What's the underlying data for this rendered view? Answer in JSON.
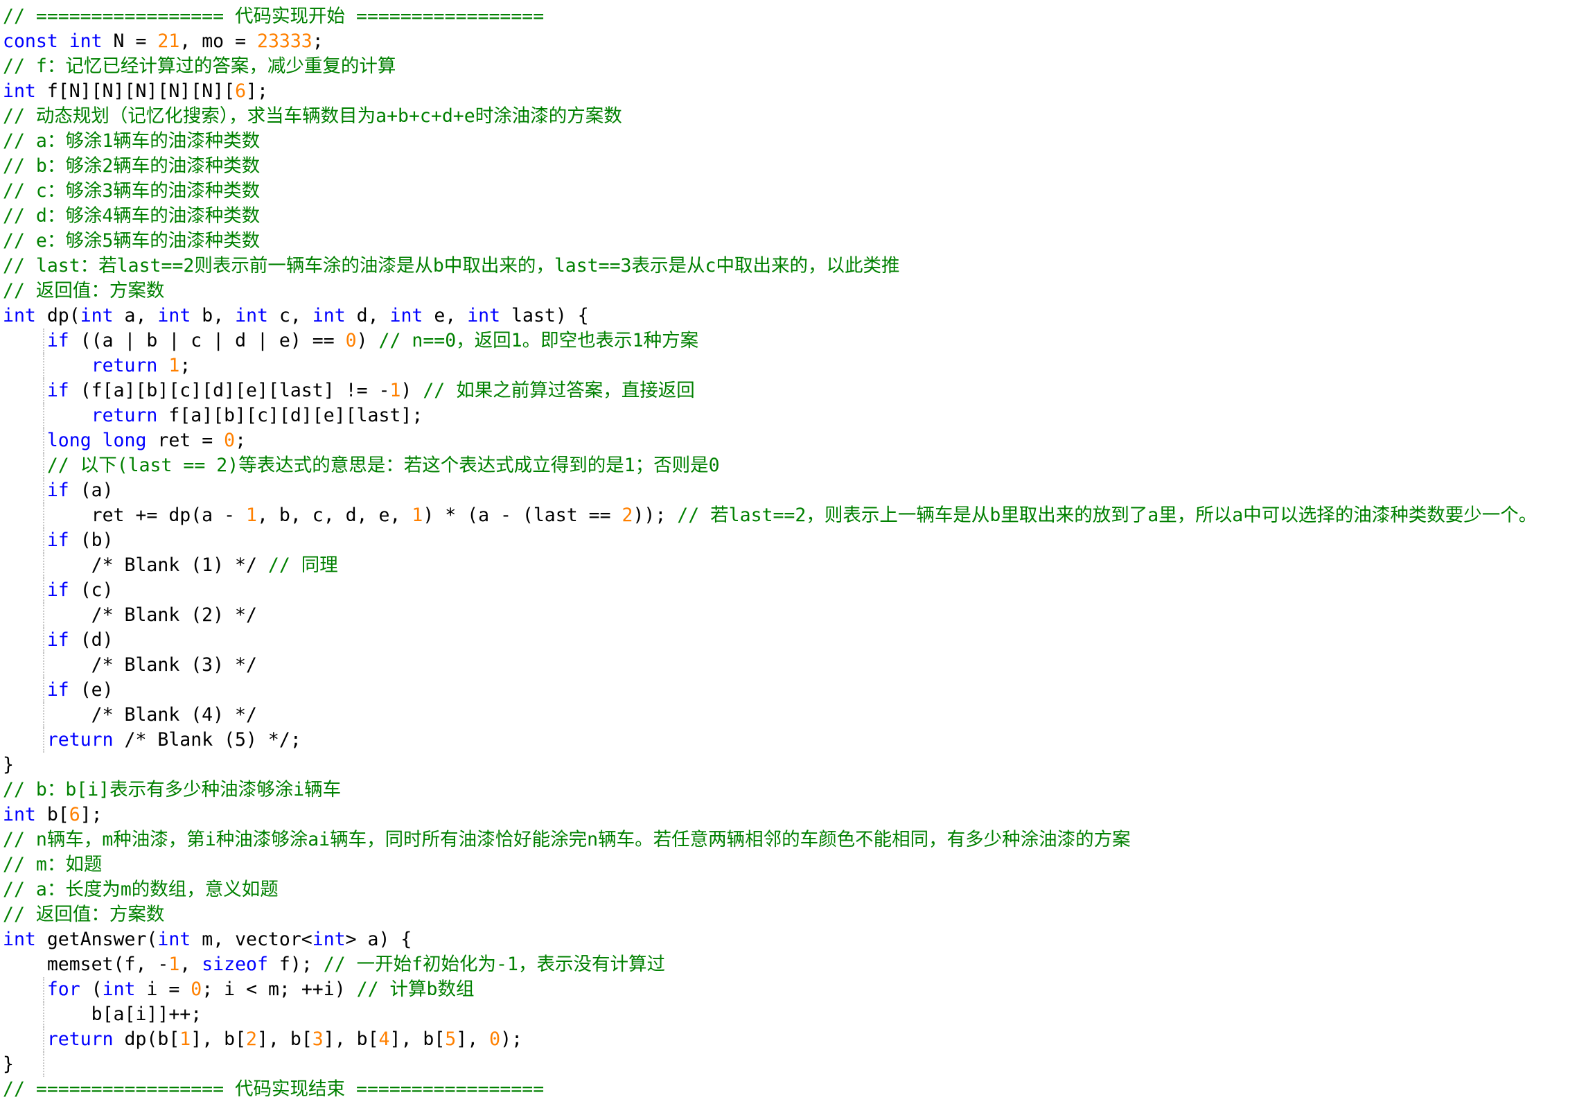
{
  "code_lines": [
    [
      {
        "t": "c",
        "s": "// ================= 代码实现开始 ================="
      }
    ],
    [
      {
        "t": "k",
        "s": "const int"
      },
      {
        "t": "p",
        "s": " N = "
      },
      {
        "t": "n",
        "s": "21"
      },
      {
        "t": "p",
        "s": ", mo = "
      },
      {
        "t": "n",
        "s": "23333"
      },
      {
        "t": "p",
        "s": ";"
      }
    ],
    [
      {
        "t": "c",
        "s": "// f：记忆已经计算过的答案，减少重复的计算"
      }
    ],
    [
      {
        "t": "k",
        "s": "int"
      },
      {
        "t": "p",
        "s": " f[N][N][N][N][N]["
      },
      {
        "t": "n",
        "s": "6"
      },
      {
        "t": "p",
        "s": "];"
      }
    ],
    [
      {
        "t": "c",
        "s": "// 动态规划（记忆化搜索），求当车辆数目为a+b+c+d+e时涂油漆的方案数"
      }
    ],
    [
      {
        "t": "c",
        "s": "// a：够涂1辆车的油漆种类数"
      }
    ],
    [
      {
        "t": "c",
        "s": "// b：够涂2辆车的油漆种类数"
      }
    ],
    [
      {
        "t": "c",
        "s": "// c：够涂3辆车的油漆种类数"
      }
    ],
    [
      {
        "t": "c",
        "s": "// d：够涂4辆车的油漆种类数"
      }
    ],
    [
      {
        "t": "c",
        "s": "// e：够涂5辆车的油漆种类数"
      }
    ],
    [
      {
        "t": "c",
        "s": "// last：若last==2则表示前一辆车涂的油漆是从b中取出来的，last==3表示是从c中取出来的，以此类推"
      }
    ],
    [
      {
        "t": "c",
        "s": "// 返回值：方案数"
      }
    ],
    [
      {
        "t": "k",
        "s": "int"
      },
      {
        "t": "p",
        "s": " dp("
      },
      {
        "t": "k",
        "s": "int"
      },
      {
        "t": "p",
        "s": " a, "
      },
      {
        "t": "k",
        "s": "int"
      },
      {
        "t": "p",
        "s": " b, "
      },
      {
        "t": "k",
        "s": "int"
      },
      {
        "t": "p",
        "s": " c, "
      },
      {
        "t": "k",
        "s": "int"
      },
      {
        "t": "p",
        "s": " d, "
      },
      {
        "t": "k",
        "s": "int"
      },
      {
        "t": "p",
        "s": " e, "
      },
      {
        "t": "k",
        "s": "int"
      },
      {
        "t": "p",
        "s": " last) {"
      }
    ],
    [
      {
        "t": "p",
        "s": "    "
      },
      {
        "t": "k",
        "s": "if"
      },
      {
        "t": "p",
        "s": " ((a | b | c | d | e) == "
      },
      {
        "t": "n",
        "s": "0"
      },
      {
        "t": "p",
        "s": ") "
      },
      {
        "t": "c",
        "s": "// n==0，返回1。即空也表示1种方案"
      }
    ],
    [
      {
        "t": "p",
        "s": "        "
      },
      {
        "t": "k",
        "s": "return"
      },
      {
        "t": "p",
        "s": " "
      },
      {
        "t": "n",
        "s": "1"
      },
      {
        "t": "p",
        "s": ";"
      }
    ],
    [
      {
        "t": "p",
        "s": "    "
      },
      {
        "t": "k",
        "s": "if"
      },
      {
        "t": "p",
        "s": " (f[a][b][c][d][e][last] != -"
      },
      {
        "t": "n",
        "s": "1"
      },
      {
        "t": "p",
        "s": ") "
      },
      {
        "t": "c",
        "s": "// 如果之前算过答案，直接返回"
      }
    ],
    [
      {
        "t": "p",
        "s": "        "
      },
      {
        "t": "k",
        "s": "return"
      },
      {
        "t": "p",
        "s": " f[a][b][c][d][e][last];"
      }
    ],
    [
      {
        "t": "p",
        "s": "    "
      },
      {
        "t": "k",
        "s": "long long"
      },
      {
        "t": "p",
        "s": " ret = "
      },
      {
        "t": "n",
        "s": "0"
      },
      {
        "t": "p",
        "s": ";"
      }
    ],
    [
      {
        "t": "p",
        "s": "    "
      },
      {
        "t": "c",
        "s": "// 以下(last == 2)等表达式的意思是：若这个表达式成立得到的是1；否则是0"
      }
    ],
    [
      {
        "t": "p",
        "s": "    "
      },
      {
        "t": "k",
        "s": "if"
      },
      {
        "t": "p",
        "s": " (a)"
      }
    ],
    [
      {
        "t": "p",
        "s": "        ret += dp(a - "
      },
      {
        "t": "n",
        "s": "1"
      },
      {
        "t": "p",
        "s": ", b, c, d, e, "
      },
      {
        "t": "n",
        "s": "1"
      },
      {
        "t": "p",
        "s": ") * (a - (last == "
      },
      {
        "t": "n",
        "s": "2"
      },
      {
        "t": "p",
        "s": ")); "
      },
      {
        "t": "c",
        "s": "// 若last==2，则表示上一辆车是从b里取出来的放到了a里，所以a中可以选择的油漆种类数要少一个。"
      }
    ],
    [
      {
        "t": "p",
        "s": "    "
      },
      {
        "t": "k",
        "s": "if"
      },
      {
        "t": "p",
        "s": " (b)"
      }
    ],
    [
      {
        "t": "p",
        "s": "        /* Blank (1) */ "
      },
      {
        "t": "c",
        "s": "// 同理"
      }
    ],
    [
      {
        "t": "p",
        "s": "    "
      },
      {
        "t": "k",
        "s": "if"
      },
      {
        "t": "p",
        "s": " (c)"
      }
    ],
    [
      {
        "t": "p",
        "s": "        /* Blank (2) */"
      }
    ],
    [
      {
        "t": "p",
        "s": "    "
      },
      {
        "t": "k",
        "s": "if"
      },
      {
        "t": "p",
        "s": " (d)"
      }
    ],
    [
      {
        "t": "p",
        "s": "        /* Blank (3) */"
      }
    ],
    [
      {
        "t": "p",
        "s": "    "
      },
      {
        "t": "k",
        "s": "if"
      },
      {
        "t": "p",
        "s": " (e)"
      }
    ],
    [
      {
        "t": "p",
        "s": "        /* Blank (4) */"
      }
    ],
    [
      {
        "t": "p",
        "s": "    "
      },
      {
        "t": "k",
        "s": "return"
      },
      {
        "t": "p",
        "s": " /* Blank (5) */;"
      }
    ],
    [
      {
        "t": "p",
        "s": "}"
      }
    ],
    [
      {
        "t": "c",
        "s": "// b：b[i]表示有多少种油漆够涂i辆车"
      }
    ],
    [
      {
        "t": "k",
        "s": "int"
      },
      {
        "t": "p",
        "s": " b["
      },
      {
        "t": "n",
        "s": "6"
      },
      {
        "t": "p",
        "s": "];"
      }
    ],
    [
      {
        "t": "c",
        "s": "// n辆车，m种油漆，第i种油漆够涂ai辆车，同时所有油漆恰好能涂完n辆车。若任意两辆相邻的车颜色不能相同，有多少种涂油漆的方案"
      }
    ],
    [
      {
        "t": "c",
        "s": "// m：如题"
      }
    ],
    [
      {
        "t": "c",
        "s": "// a：长度为m的数组，意义如题"
      }
    ],
    [
      {
        "t": "c",
        "s": "// 返回值：方案数"
      }
    ],
    [
      {
        "t": "k",
        "s": "int"
      },
      {
        "t": "p",
        "s": " getAnswer("
      },
      {
        "t": "k",
        "s": "int"
      },
      {
        "t": "p",
        "s": " m, vector<"
      },
      {
        "t": "k",
        "s": "int"
      },
      {
        "t": "p",
        "s": "> a) {"
      }
    ],
    [
      {
        "t": "p",
        "s": "    memset(f, -"
      },
      {
        "t": "n",
        "s": "1"
      },
      {
        "t": "p",
        "s": ", "
      },
      {
        "t": "k",
        "s": "sizeof"
      },
      {
        "t": "p",
        "s": " f); "
      },
      {
        "t": "c",
        "s": "// 一开始f初始化为-1，表示没有计算过"
      }
    ],
    [
      {
        "t": "p",
        "s": "    "
      },
      {
        "t": "k",
        "s": "for"
      },
      {
        "t": "p",
        "s": " ("
      },
      {
        "t": "k",
        "s": "int"
      },
      {
        "t": "p",
        "s": " i = "
      },
      {
        "t": "n",
        "s": "0"
      },
      {
        "t": "p",
        "s": "; i < m; ++i) "
      },
      {
        "t": "c",
        "s": "// 计算b数组"
      }
    ],
    [
      {
        "t": "p",
        "s": "        b[a[i]]++;"
      }
    ],
    [
      {
        "t": "p",
        "s": "    "
      },
      {
        "t": "k",
        "s": "return"
      },
      {
        "t": "p",
        "s": " dp(b["
      },
      {
        "t": "n",
        "s": "1"
      },
      {
        "t": "p",
        "s": "], b["
      },
      {
        "t": "n",
        "s": "2"
      },
      {
        "t": "p",
        "s": "], b["
      },
      {
        "t": "n",
        "s": "3"
      },
      {
        "t": "p",
        "s": "], b["
      },
      {
        "t": "n",
        "s": "4"
      },
      {
        "t": "p",
        "s": "], b["
      },
      {
        "t": "n",
        "s": "5"
      },
      {
        "t": "p",
        "s": "], "
      },
      {
        "t": "n",
        "s": "0"
      },
      {
        "t": "p",
        "s": ");"
      }
    ],
    [
      {
        "t": "p",
        "s": "}"
      }
    ],
    [
      {
        "t": "c",
        "s": "// ================= 代码实现结束 ================="
      }
    ]
  ],
  "colors": {
    "comment": "#008000",
    "keyword": "#0000ff",
    "number": "#ff8000",
    "plain": "#000000",
    "background": "#ffffff"
  }
}
